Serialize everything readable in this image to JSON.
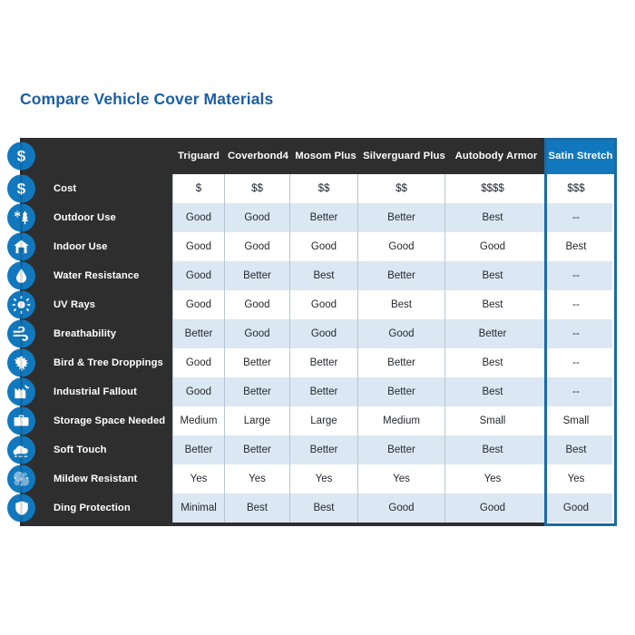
{
  "page": {
    "title": "Compare Vehicle Cover Materials",
    "accent_blue": "#1278bd",
    "title_blue": "#1b5fa6",
    "panel_dark": "#2e2e2e",
    "row_alt_blue": "#dbe7f2",
    "highlight_border": "#1b6ba8"
  },
  "table": {
    "header_icon": "dollar-icon",
    "columns": [
      {
        "label": "Triguard",
        "highlighted": false
      },
      {
        "label": "Coverbond4",
        "highlighted": false
      },
      {
        "label": "Mosom Plus",
        "highlighted": false
      },
      {
        "label": "Silverguard Plus",
        "highlighted": false
      },
      {
        "label": "Autobody Armor",
        "highlighted": false
      },
      {
        "label": "Satin Stretch",
        "highlighted": true
      }
    ],
    "rows": [
      {
        "label": "Cost",
        "icon": "dollar-icon",
        "values": [
          "$",
          "$$",
          "$$",
          "$$",
          "$$$$",
          "$$$"
        ]
      },
      {
        "label": "Outdoor Use",
        "icon": "snowflake-tree-icon",
        "values": [
          "Good",
          "Good",
          "Better",
          "Better",
          "Best",
          "--"
        ]
      },
      {
        "label": "Indoor Use",
        "icon": "garage-home-icon",
        "values": [
          "Good",
          "Good",
          "Good",
          "Good",
          "Good",
          "Best"
        ]
      },
      {
        "label": "Water Resistance",
        "icon": "water-drop-icon",
        "values": [
          "Good",
          "Better",
          "Best",
          "Better",
          "Best",
          "--"
        ]
      },
      {
        "label": "UV Rays",
        "icon": "sun-icon",
        "values": [
          "Good",
          "Good",
          "Good",
          "Best",
          "Best",
          "--"
        ]
      },
      {
        "label": "Breathability",
        "icon": "wind-icon",
        "values": [
          "Better",
          "Good",
          "Good",
          "Good",
          "Better",
          "--"
        ]
      },
      {
        "label": "Bird & Tree Droppings",
        "icon": "leaf-icon",
        "values": [
          "Good",
          "Better",
          "Better",
          "Better",
          "Best",
          "--"
        ]
      },
      {
        "label": "Industrial Fallout",
        "icon": "factory-icon",
        "values": [
          "Good",
          "Better",
          "Better",
          "Better",
          "Best",
          "--"
        ]
      },
      {
        "label": "Storage Space Needed",
        "icon": "briefcase-icon",
        "values": [
          "Medium",
          "Large",
          "Large",
          "Medium",
          "Small",
          "Small"
        ]
      },
      {
        "label": "Soft Touch",
        "icon": "cloud-icon",
        "values": [
          "Better",
          "Better",
          "Better",
          "Better",
          "Best",
          "Best"
        ]
      },
      {
        "label": "Mildew Resistant",
        "icon": "mildew-spots-icon",
        "values": [
          "Yes",
          "Yes",
          "Yes",
          "Yes",
          "Yes",
          "Yes"
        ]
      },
      {
        "label": "Ding Protection",
        "icon": "shield-icon",
        "values": [
          "Minimal",
          "Best",
          "Best",
          "Good",
          "Good",
          "Good"
        ]
      }
    ]
  }
}
